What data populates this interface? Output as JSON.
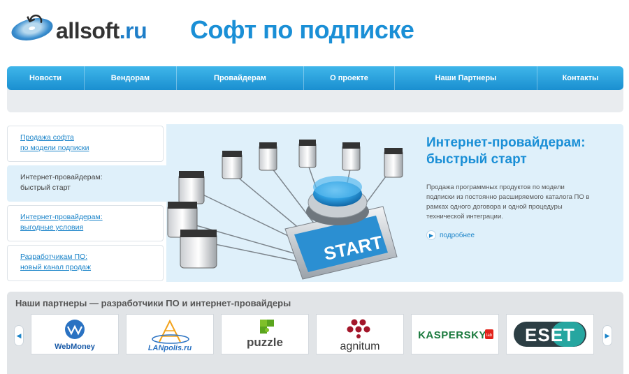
{
  "header": {
    "logo_main": "allsoft",
    "logo_dot": ".",
    "logo_ru": "ru",
    "tagline": "Софт по подписке"
  },
  "nav": {
    "items": [
      "Новости",
      "Вендорам",
      "Провайдерам",
      "О проекте",
      "Наши Партнеры",
      "Контакты"
    ]
  },
  "sidebar": {
    "items": [
      {
        "line1": "Продажа софта",
        "line2": "по модели подписки",
        "active": false
      },
      {
        "line1": "Интернет-провайдерам:",
        "line2": "быстрый старт",
        "active": true
      },
      {
        "line1": "Интернет-провайдерам:",
        "line2": "выгодные условия",
        "active": false
      },
      {
        "line1": "Разработчикам ПО:",
        "line2": "новый канал продаж",
        "active": false
      }
    ]
  },
  "banner": {
    "title_line1": "Интернет-провайдерам:",
    "title_line2": "быстрый старт",
    "text_lines": [
      "Продажа программных продуктов по модели",
      "подписки из постоянно расширяемого каталога ПО в",
      "рамках одного договора и одной процедуры",
      "технической интеграции."
    ],
    "more_label": "подробнее",
    "button_label": "START"
  },
  "partners": {
    "title": "Наши партнеры — разработчики ПО и интернет-провайдеры",
    "prev_icon": "chevron-left-icon",
    "next_icon": "chevron-right-icon",
    "logos": [
      {
        "name": "WebMoney"
      },
      {
        "name": "LANpolis.ru"
      },
      {
        "name": "puzzle"
      },
      {
        "name": "agnitum"
      },
      {
        "name": "KASPERSKY",
        "sup": "lab"
      },
      {
        "name": "ESET"
      }
    ]
  },
  "colors": {
    "brand_blue": "#1a8fd6",
    "nav_top": "#3fb6ea",
    "nav_bottom": "#1a8fd0",
    "banner_bg": "#dff0fa",
    "partners_bg": "#e1e4e7"
  }
}
